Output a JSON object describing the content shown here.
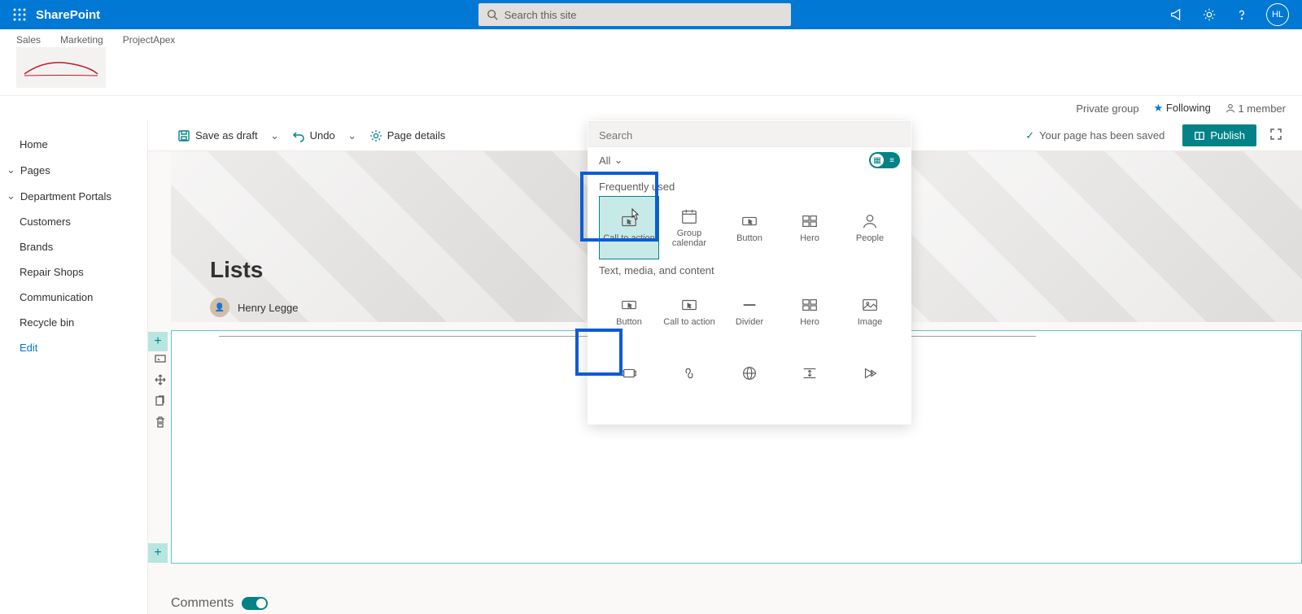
{
  "topbar": {
    "app_name": "SharePoint",
    "search_placeholder": "Search this site",
    "avatar_initials": "HL"
  },
  "crumbs": [
    "Sales",
    "Marketing",
    "ProjectApex"
  ],
  "group_info": {
    "private": "Private group",
    "following": "Following",
    "members": "1 member"
  },
  "sidebar": [
    {
      "label": "Home",
      "parent": false
    },
    {
      "label": "Pages",
      "parent": true
    },
    {
      "label": "Department Portals",
      "parent": true
    },
    {
      "label": "Customers",
      "parent": false
    },
    {
      "label": "Brands",
      "parent": false
    },
    {
      "label": "Repair Shops",
      "parent": false
    },
    {
      "label": "Communication",
      "parent": false
    },
    {
      "label": "Recycle bin",
      "parent": false
    },
    {
      "label": "Edit",
      "parent": false,
      "edit": true
    }
  ],
  "cmdbar": {
    "save": "Save as draft",
    "undo": "Undo",
    "details": "Page details",
    "saved_msg": "Your page has been saved",
    "publish": "Publish"
  },
  "page": {
    "title": "Lists",
    "author": "Henry Legge",
    "comments_label": "Comments"
  },
  "picker": {
    "search_placeholder": "Search",
    "filter_label": "All",
    "sections": [
      {
        "title": "Frequently used",
        "items": [
          {
            "name": "Call to action",
            "selected": true,
            "icon": "cta"
          },
          {
            "name": "Group calendar",
            "icon": "calendar"
          },
          {
            "name": "Button",
            "icon": "button"
          },
          {
            "name": "Hero",
            "icon": "hero"
          },
          {
            "name": "People",
            "icon": "people"
          }
        ]
      },
      {
        "title": "Text, media, and content",
        "items": [
          {
            "name": "Button",
            "icon": "button"
          },
          {
            "name": "Call to action",
            "icon": "cta"
          },
          {
            "name": "Divider",
            "icon": "divider"
          },
          {
            "name": "Hero",
            "icon": "hero"
          },
          {
            "name": "Image",
            "icon": "image"
          },
          {
            "name": "",
            "icon": "gallery"
          },
          {
            "name": "",
            "icon": "link"
          },
          {
            "name": "",
            "icon": "globe"
          },
          {
            "name": "",
            "icon": "spacer"
          },
          {
            "name": "",
            "icon": "stream"
          }
        ]
      }
    ]
  }
}
